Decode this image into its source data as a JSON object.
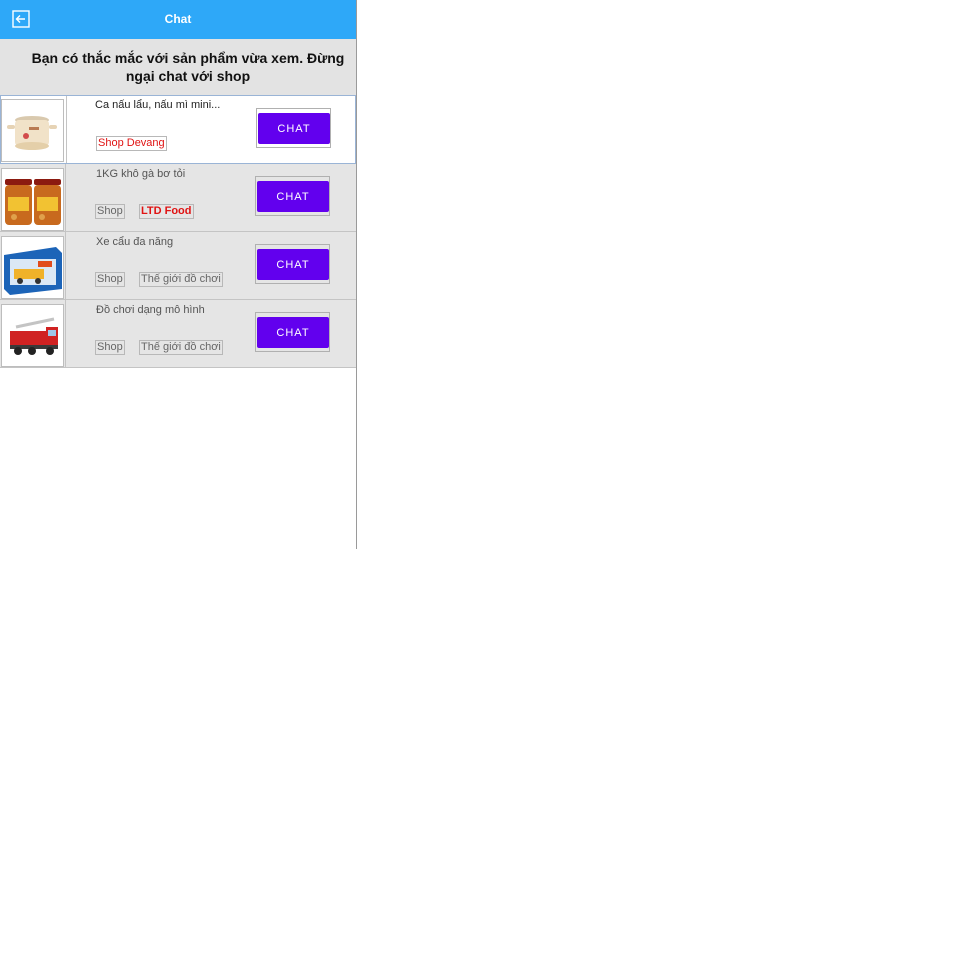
{
  "header": {
    "title": "Chat",
    "back_icon": "back-arrow-icon",
    "color": "#2ea8f8"
  },
  "notice": {
    "text": "Bạn có thắc mắc với sản phẩm vừa xem. Đừng ngại chat với shop"
  },
  "products": [
    {
      "name": "Ca nấu lẩu, nấu mì mini...",
      "tags": [
        "Shop Devang"
      ],
      "chat_label": "CHAT",
      "image": "electric-pot-image"
    },
    {
      "name": "1KG khô gà bơ tỏi",
      "tags": [
        "Shop",
        "LTD Food"
      ],
      "chat_label": "CHAT",
      "image": "chicken-jar-image"
    },
    {
      "name": "Xe cẩu đa năng",
      "tags": [
        "Shop",
        "Thế giới đồ chơi"
      ],
      "chat_label": "CHAT",
      "image": "toy-crane-box-image"
    },
    {
      "name": "Đồ chơi dạng mô hình",
      "tags": [
        "Shop",
        "Thế giới đồ chơi"
      ],
      "chat_label": "CHAT",
      "image": "fire-truck-toy-image"
    }
  ],
  "colors": {
    "chat_button": "#6200ee",
    "shop_name_highlight": "#e01212"
  }
}
